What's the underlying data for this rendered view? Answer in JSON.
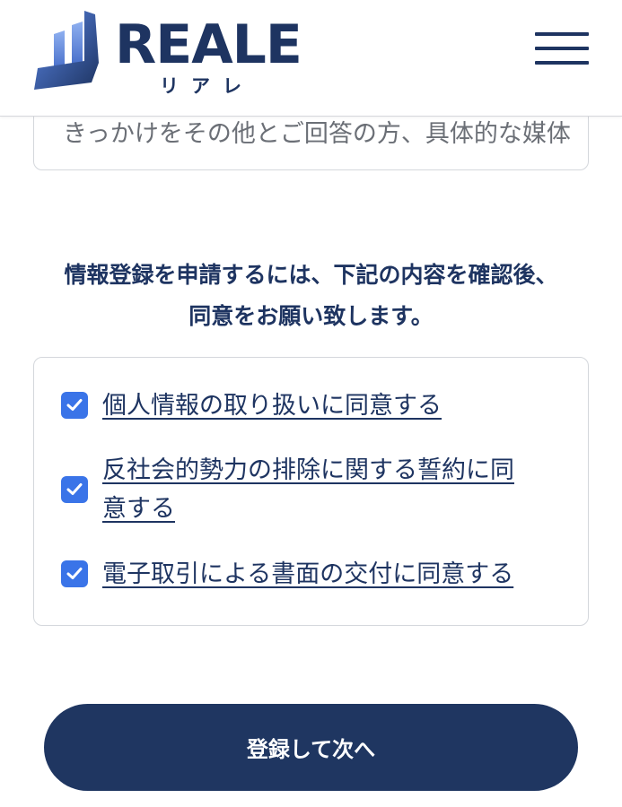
{
  "header": {
    "logo_text": "REALE",
    "logo_kana": "リアレ",
    "menu_icon": "hamburger-menu-icon"
  },
  "form": {
    "referral_detail_value": "きっかけをその他とご回答の方、具体的な媒体"
  },
  "consent": {
    "intro_line1": "情報登録を申請するには、下記の内容を確認後、",
    "intro_line2": "同意をお願い致します。",
    "items": [
      {
        "label": "個人情報の取り扱いに同意する",
        "checked": true
      },
      {
        "label_line1": "反社会的勢力の排除に関する誓約に同",
        "label_line2": "意する",
        "checked": true
      },
      {
        "label": "電子取引による書面の交付に同意する",
        "checked": true
      }
    ]
  },
  "submit": {
    "label": "登録して次へ"
  },
  "colors": {
    "brand_navy": "#1e3461",
    "checkbox_blue": "#3a74e8",
    "border_gray": "#d4d7dc"
  }
}
